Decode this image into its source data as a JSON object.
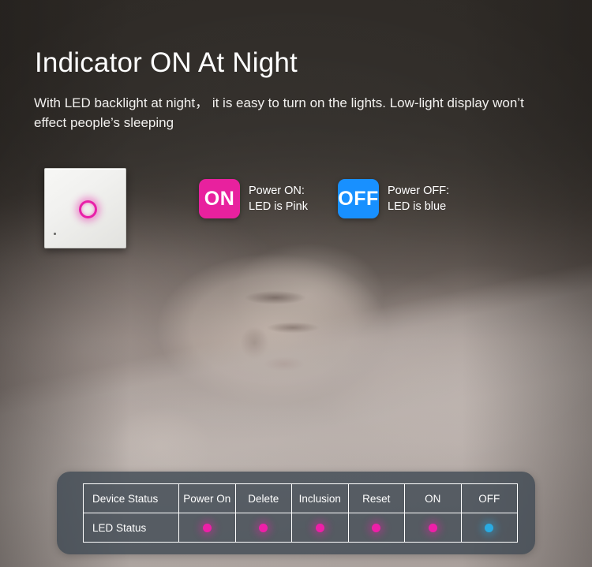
{
  "header": {
    "title": "Indicator ON At Night",
    "subtitle": "With LED backlight at night，  it is easy to turn on the lights. Low-light display won’t effect people’s sleeping"
  },
  "product": {
    "name": "touch-wall-switch",
    "indicator_color": "#e820a8"
  },
  "legend": [
    {
      "badge_label": "ON",
      "badge_color": "#e8219e",
      "description_line1": "Power ON:",
      "description_line2": "LED is Pink"
    },
    {
      "badge_label": "OFF",
      "badge_color": "#1890ff",
      "description_line1": "Power OFF:",
      "description_line2": "LED is blue"
    }
  ],
  "status_table": {
    "row_labels": [
      "Device Status",
      "LED Status"
    ],
    "columns": [
      "Power On",
      "Delete",
      "Inclusion",
      "Reset",
      "ON",
      "OFF"
    ],
    "led_states": [
      {
        "column": "Power On",
        "color": "#ee1fa8",
        "name": "pink"
      },
      {
        "column": "Delete",
        "color": "#ee1fa8",
        "name": "pink"
      },
      {
        "column": "Inclusion",
        "color": "#ee1fa8",
        "name": "pink"
      },
      {
        "column": "Reset",
        "color": "#ee1fa8",
        "name": "pink"
      },
      {
        "column": "ON",
        "color": "#ee1fa8",
        "name": "pink"
      },
      {
        "column": "OFF",
        "color": "#29abe2",
        "name": "blue"
      }
    ]
  }
}
